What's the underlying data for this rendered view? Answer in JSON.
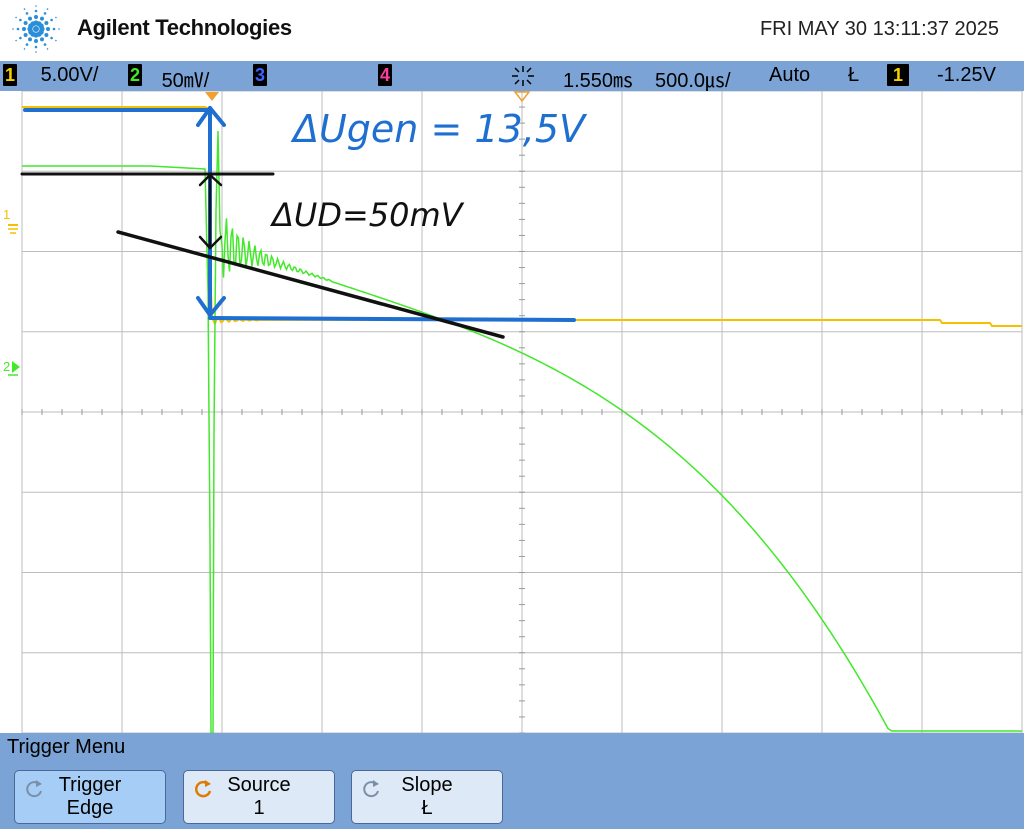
{
  "header": {
    "brand": "Agilent Technologies",
    "datetime": "FRI MAY 30 13:11:37 2025"
  },
  "status": {
    "ch1": {
      "num": "1",
      "scale": "5.00V/"
    },
    "ch2": {
      "num": "2",
      "scale": "50㎷/"
    },
    "ch3": {
      "num": "3"
    },
    "ch4": {
      "num": "4"
    },
    "delay": "1.550㎳",
    "timebase": "500.0㎲/",
    "trig_mode": "Auto",
    "trig_slope_symbol": "Ł",
    "trig_source_num": "1",
    "trig_level": "-1.25V"
  },
  "colors": {
    "ch1": "#f5c000",
    "ch2": "#42e82a",
    "annotation_blue": "#1e6fd0",
    "annotation_black": "#111111",
    "statusbar": "#7ba3d6"
  },
  "screen": {
    "annotations": {
      "delta_u_gen": "ΔUgen = 13,5V",
      "delta_u_d": "ΔUD=50mV"
    },
    "markers": {
      "ch1_ground": "1",
      "ch2_ground": "2"
    }
  },
  "menu": {
    "title": "Trigger Menu",
    "softkeys": [
      {
        "line1": "Trigger",
        "line2": "Edge",
        "icon": "rotate-icon"
      },
      {
        "line1": "Source",
        "line2": "1",
        "icon": "rotate-icon"
      },
      {
        "line1": "Slope",
        "line2": "Ł",
        "icon": "rotate-icon"
      }
    ]
  }
}
